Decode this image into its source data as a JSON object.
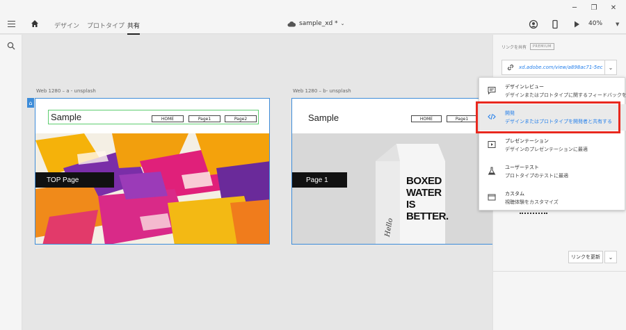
{
  "header": {
    "tabs": [
      {
        "label": "デザイン"
      },
      {
        "label": "プロトタイプ"
      },
      {
        "label": "共有"
      }
    ],
    "doc_name": "sample_xd *",
    "zoom": "40%"
  },
  "artboards": [
    {
      "label": "Web 1280 – a - unsplash",
      "site_title": "Sample",
      "nav": [
        "HOME",
        "Page1",
        "Page2"
      ],
      "hero_label": "TOP Page"
    },
    {
      "label": "Web 1280 – b- unsplash",
      "site_title": "Sample",
      "nav": [
        "HOME",
        "Page1"
      ],
      "hero_label": "Page 1",
      "product_text": [
        "BOXED",
        "WATER",
        "IS",
        "BETTER."
      ],
      "product_small": "Hello"
    }
  ],
  "share_panel": {
    "title": "リンクを共有",
    "badge": "PREMIUM",
    "link": "xd.adobe.com/view/a898ac71-5ec",
    "update_button": "リンクを更新"
  },
  "share_menu": [
    {
      "title": "デザインレビュー",
      "desc": "デザインまたはプロトタイプに関するフィードバックを得る",
      "icon": "comment-icon"
    },
    {
      "title": "開発",
      "desc": "デザインまたはプロトタイプを開発者と共有する",
      "icon": "code-icon",
      "selected": true
    },
    {
      "title": "プレゼンテーション",
      "desc": "デザインのプレゼンテーションに最適",
      "icon": "play-box-icon"
    },
    {
      "title": "ユーザーテスト",
      "desc": "プロトタイプのテストに最適",
      "icon": "flask-icon"
    },
    {
      "title": "カスタム",
      "desc": "視聴体験をカスタマイズ",
      "icon": "window-icon"
    }
  ],
  "colors": {
    "accent": "#2680eb",
    "artboard_border": "#3d8cd9",
    "highlight": "#e8281e"
  }
}
